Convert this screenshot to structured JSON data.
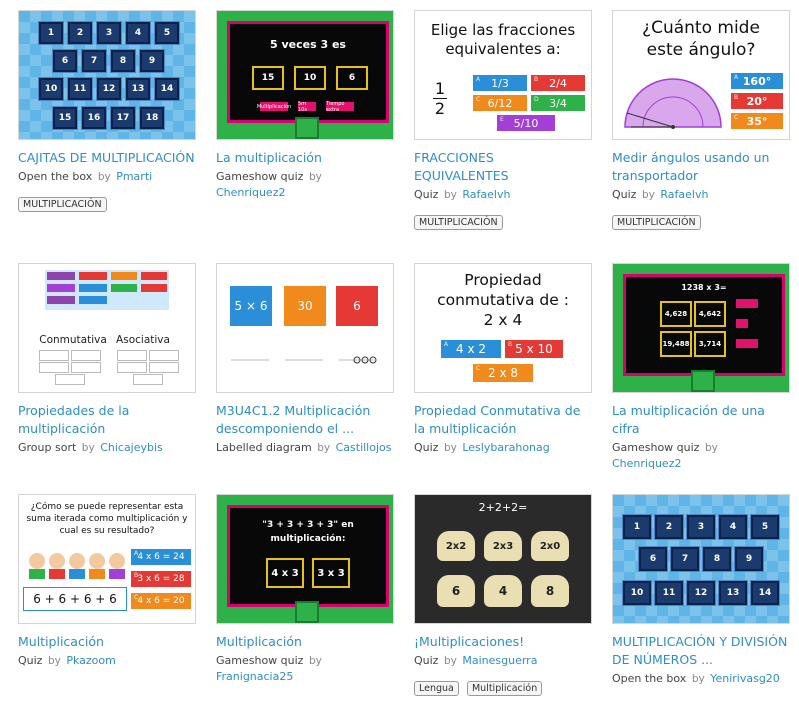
{
  "cards": [
    {
      "title": "CAJITAS DE MULTIPLICACIÓN",
      "type": "Open the box",
      "by": "by",
      "author": "Pmarti",
      "tags": [
        "MULTIPLICACIÓN"
      ],
      "thumb": {
        "boxes": [
          "1",
          "2",
          "3",
          "4",
          "5",
          "6",
          "7",
          "8",
          "9",
          "10",
          "11",
          "12",
          "13",
          "14",
          "15",
          "16",
          "17",
          "18"
        ]
      }
    },
    {
      "title": "La multiplicación",
      "type": "Gameshow quiz",
      "by": "by",
      "author": "Chenriquez2",
      "tags": [],
      "thumb": {
        "question": "5 veces 3 es",
        "answers": [
          "15",
          "10",
          "6"
        ],
        "pill1": "Multiplicación",
        "pill2": "5m 10s",
        "pill3": "Tiempo extra"
      }
    },
    {
      "title": "FRACCIONES EQUIVALENTES",
      "type": "Quiz",
      "by": "by",
      "author": "Rafaelvh",
      "tags": [
        "MULTIPLICACIÓN"
      ],
      "thumb": {
        "heading": "Elige las fracciones equivalentes a:",
        "frac_num": "1",
        "frac_den": "2",
        "options": [
          {
            "key": "A",
            "text": "1/3"
          },
          {
            "key": "B",
            "text": "2/4"
          },
          {
            "key": "C",
            "text": "6/12"
          },
          {
            "key": "D",
            "text": "3/4"
          },
          {
            "key": "E",
            "text": "5/10"
          }
        ]
      }
    },
    {
      "title": "Medir ángulos usando un transportador",
      "type": "Quiz",
      "by": "by",
      "author": "Rafaelvh",
      "tags": [
        "MULTIPLICACIÓN"
      ],
      "thumb": {
        "heading": "¿Cuánto mide este ángulo?",
        "options": [
          {
            "key": "A",
            "text": "160°"
          },
          {
            "key": "B",
            "text": "20°"
          },
          {
            "key": "C",
            "text": "35°"
          }
        ]
      }
    },
    {
      "title": "Propiedades de la multiplicación",
      "type": "Group sort",
      "by": "by",
      "author": "Chicajeybis",
      "tags": [],
      "thumb": {
        "group1": "Conmutativa",
        "group2": "Asociativa"
      }
    },
    {
      "title": "M3U4C1.2 Multiplicación descomponiendo el ...",
      "type": "Labelled diagram",
      "by": "by",
      "author": "Castillojos",
      "tags": [],
      "thumb": {
        "labels": [
          "5 × 6",
          "30",
          "6"
        ]
      }
    },
    {
      "title": "Propiedad Conmutativa de la multiplicación",
      "type": "Quiz",
      "by": "by",
      "author": "Leslybarahonag",
      "tags": [],
      "thumb": {
        "heading": "Propiedad conmutativa de : 2 x 4",
        "options": [
          {
            "key": "A",
            "text": "4 x 2"
          },
          {
            "key": "B",
            "text": "5 x 10"
          },
          {
            "key": "C",
            "text": "2 x 8"
          }
        ]
      }
    },
    {
      "title": "La multiplicación de una cifra",
      "type": "Gameshow quiz",
      "by": "by",
      "author": "Chenriquez2",
      "tags": [],
      "thumb": {
        "question": "1238 x 3=",
        "answers": [
          "4,628",
          "4,642",
          "19,488",
          "3,714"
        ]
      }
    },
    {
      "title": "Multiplicación",
      "type": "Quiz",
      "by": "by",
      "author": "Pkazoom",
      "tags": [],
      "thumb": {
        "heading": "¿Cómo se puede representar esta suma iterada como multiplicación y cual es su resultado?",
        "sum": "6 + 6 + 6 + 6",
        "options": [
          {
            "key": "A",
            "text": "4 x 6 = 24"
          },
          {
            "key": "B",
            "text": "3 x 6 = 28"
          },
          {
            "key": "C",
            "text": "4 x 6 = 20"
          }
        ]
      }
    },
    {
      "title": "Multiplicación",
      "type": "Gameshow quiz",
      "by": "by",
      "author": "Franignacia25",
      "tags": [],
      "thumb": {
        "question": "\"3 + 3 + 3 + 3\" en multiplicación:",
        "answers": [
          "4 x 3",
          "3 x 3"
        ]
      }
    },
    {
      "title": "¡Multiplicaciones!",
      "type": "Quiz",
      "by": "by",
      "author": "Mainesguerra",
      "tags": [
        "Lengua",
        "Multiplicación"
      ],
      "thumb": {
        "heading": "2+2+2=",
        "skulls": [
          "2x2",
          "2x3",
          "2x0",
          "6",
          "4",
          "8"
        ]
      }
    },
    {
      "title": "MULTIPLICACIÓN Y DIVISIÓN DE NÚMEROS ...",
      "type": "Open the box",
      "by": "by",
      "author": "Yenirivasg20",
      "tags": [],
      "thumb": {
        "boxes": [
          "1",
          "2",
          "3",
          "4",
          "5",
          "6",
          "7",
          "8",
          "9",
          "10",
          "11",
          "12",
          "13",
          "14"
        ]
      }
    }
  ],
  "colors": {
    "link": "#2f8ec6",
    "show_green": "#2fb14a",
    "show_frame": "#d6006e",
    "opt_blue": "#2a8fd8",
    "opt_red": "#e53935",
    "opt_orange": "#f08a1c",
    "opt_purple": "#a23fd6"
  }
}
